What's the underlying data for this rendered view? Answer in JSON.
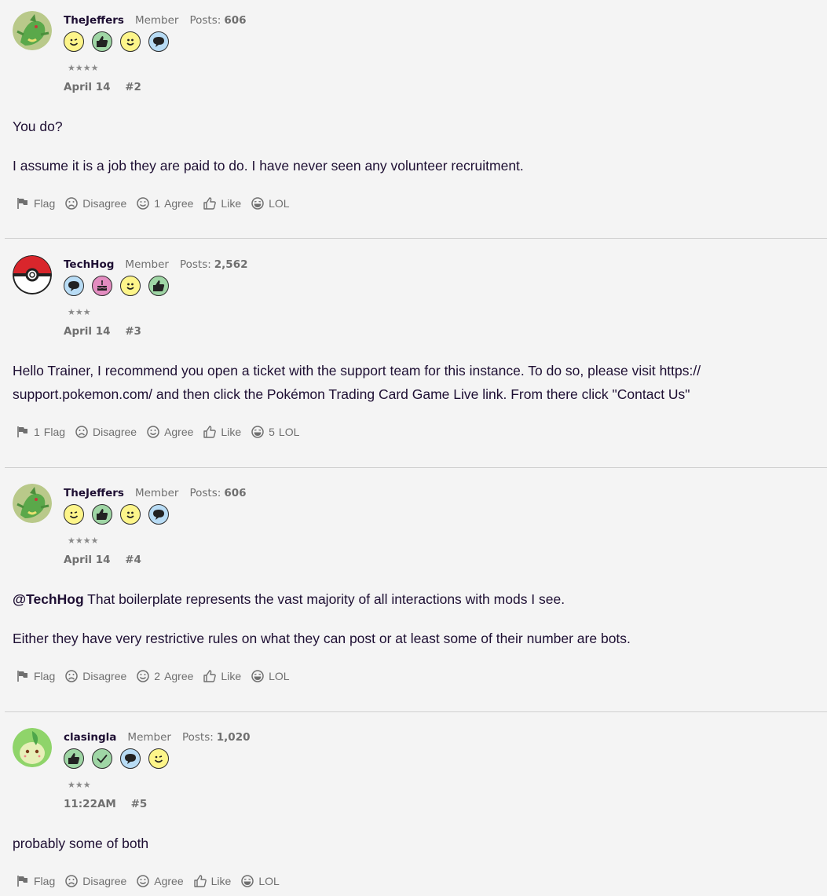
{
  "posts": [
    {
      "username": "TheJeffers",
      "role": "Member",
      "posts_label": "Posts:",
      "posts_count": "606",
      "stars": "★★★★",
      "badges": [
        "wink-badge",
        "like-badge",
        "smile-badge",
        "comment-badge"
      ],
      "date": "April 14",
      "number": "#2",
      "paragraphs": [
        "You do?",
        "I assume it is a job they are paid to do. I have never seen any volunteer recruitment."
      ],
      "reactions": {
        "flag": "Flag",
        "disagree": "Disagree",
        "agree_count": "1",
        "agree": "Agree",
        "like": "Like",
        "lol": "LOL"
      }
    },
    {
      "username": "TechHog",
      "role": "Member",
      "posts_label": "Posts:",
      "posts_count": "2,562",
      "stars": "★★★",
      "badges": [
        "comment-badge",
        "cake-badge",
        "smile-badge",
        "like-badge"
      ],
      "date": "April 14",
      "number": "#3",
      "paragraphs": [
        "Hello Trainer, I recommend you open a ticket with the support team for this instance. To do so, please visit https:// support.pokemon.com/ and then click the Pokémon Trading Card Game Live link. From there click \"Contact Us\""
      ],
      "reactions": {
        "flag_count": "1",
        "flag": "Flag",
        "disagree": "Disagree",
        "agree": "Agree",
        "like": "Like",
        "lol_count": "5",
        "lol": "LOL"
      }
    },
    {
      "username": "TheJeffers",
      "role": "Member",
      "posts_label": "Posts:",
      "posts_count": "606",
      "stars": "★★★★",
      "badges": [
        "wink-badge",
        "like-badge",
        "smile-badge",
        "comment-badge"
      ],
      "date": "April 14",
      "number": "#4",
      "mention": "@TechHog",
      "paragraphs": [
        " That boilerplate represents the vast majority of all interactions with mods I see.",
        "Either they have very restrictive rules on what they can post or at least some of their number are bots."
      ],
      "reactions": {
        "flag": "Flag",
        "disagree": "Disagree",
        "agree_count": "2",
        "agree": "Agree",
        "like": "Like",
        "lol": "LOL"
      }
    },
    {
      "username": "clasingla",
      "role": "Member",
      "posts_label": "Posts:",
      "posts_count": "1,020",
      "stars": "★★★",
      "badges": [
        "like-badge",
        "check-badge",
        "comment-badge",
        "wink-badge"
      ],
      "date": "11:22AM",
      "number": "#5",
      "paragraphs": [
        "probably some of both"
      ],
      "reactions": {
        "flag": "Flag",
        "disagree": "Disagree",
        "agree": "Agree",
        "like": "Like",
        "lol": "LOL"
      }
    }
  ]
}
